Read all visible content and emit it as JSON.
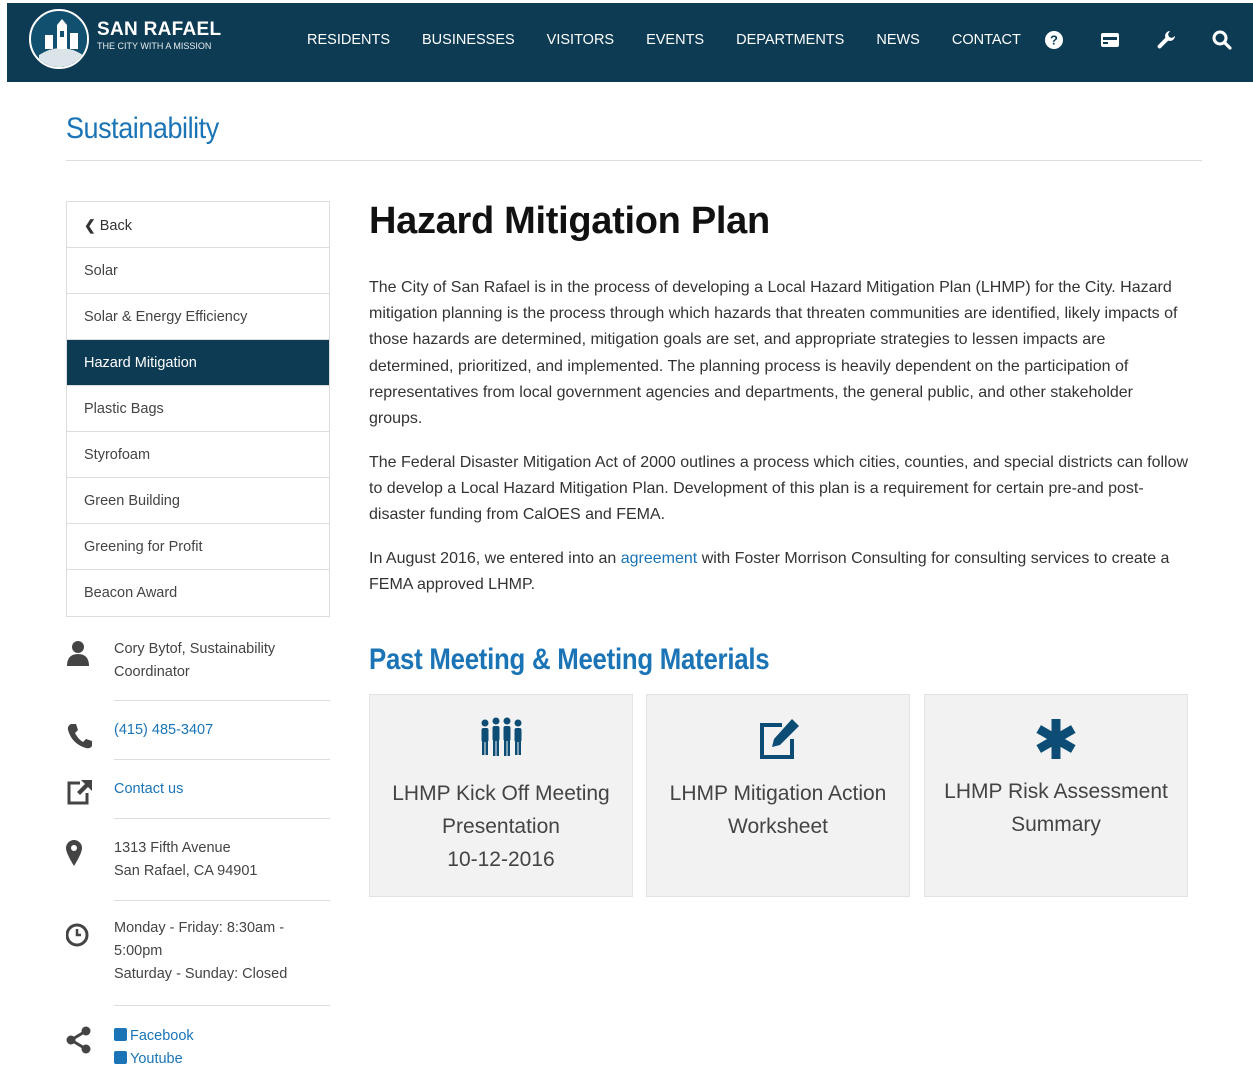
{
  "header": {
    "logo_title": "SAN RAFAEL",
    "logo_subtitle": "THE CITY WITH A MISSION",
    "nav": [
      "RESIDENTS",
      "BUSINESSES",
      "VISITORS",
      "EVENTS",
      "DEPARTMENTS",
      "NEWS",
      "CONTACT"
    ],
    "tools": [
      "help-icon",
      "payment-card-icon",
      "wrench-icon",
      "search-icon"
    ]
  },
  "section_title": "Sustainability",
  "sidenav": {
    "back_label": "Back",
    "items": [
      "Solar",
      "Solar & Energy Efficiency",
      "Hazard Mitigation",
      "Plastic Bags",
      "Styrofoam",
      "Green Building",
      "Greening for Profit",
      "Beacon Award"
    ],
    "active": "Hazard Mitigation"
  },
  "contact": {
    "name_line1": "Cory Bytof, Sustainability",
    "name_line2": "Coordinator",
    "phone": "(415) 485-3407",
    "contact_link": "Contact us",
    "address_line1": "1313 Fifth Avenue",
    "address_line2": "San Rafael, CA 94901",
    "hours_line1": "Monday - Friday: 8:30am -",
    "hours_line2": "5:00pm",
    "hours_line3": "Saturday - Sunday: Closed",
    "social_facebook": "Facebook",
    "social_youtube": "Youtube"
  },
  "main": {
    "title": "Hazard Mitigation Plan",
    "p1": "The City of San Rafael is in the process of developing a Local Hazard Mitigation Plan (LHMP) for the City. Hazard mitigation planning is the process through which hazards that threaten communities are identified, likely impacts of those hazards are determined, mitigation goals are set, and appropriate strategies to lessen impacts are determined, prioritized, and implemented. The planning process is heavily dependent on the participation of representatives from local government agencies and departments, the general public, and other stakeholder groups.",
    "p2": "The Federal Disaster Mitigation Act of 2000 outlines a process which cities, counties, and special districts can follow to develop a Local Hazard Mitigation Plan. Development of this plan is a requirement for certain pre-and post-disaster funding from CalOES and FEMA.",
    "p3_before": "In August 2016, we entered into an ",
    "p3_link": "agreement",
    "p3_after": " with Foster Morrison Consulting for consulting services to create a FEMA approved LHMP.",
    "subtitle": "Past Meeting & Meeting Materials",
    "cards": [
      {
        "icon": "group-icon",
        "line1": "LHMP Kick Off Meeting",
        "line2": "Presentation",
        "line3": "10-12-2016"
      },
      {
        "icon": "edit-icon",
        "line1": "LHMP Mitigation Action",
        "line2": "Worksheet",
        "line3": ""
      },
      {
        "icon": "asterisk-icon",
        "line1": "LHMP Risk Assessment",
        "line2": "Summary",
        "line3": ""
      }
    ]
  }
}
